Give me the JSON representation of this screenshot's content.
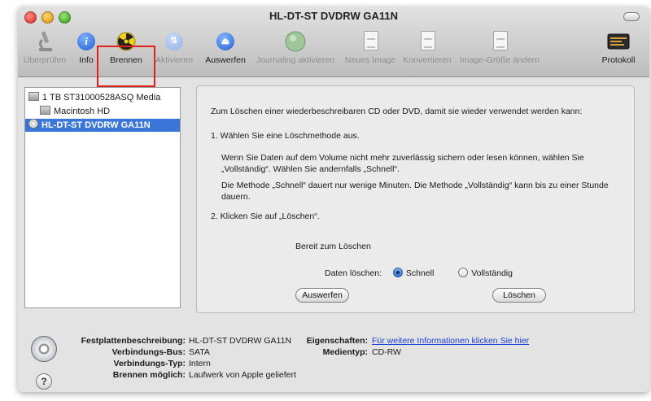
{
  "window": {
    "title": "HL-DT-ST DVDRW GA11N"
  },
  "toolbar": {
    "items": [
      {
        "label": "Überprüfen",
        "icon": "microscope-icon",
        "enabled": false
      },
      {
        "label": "Info",
        "icon": "info-icon",
        "enabled": true
      },
      {
        "label": "Brennen",
        "icon": "burn-icon",
        "enabled": true
      },
      {
        "label": "Aktivieren",
        "icon": "activate-icon",
        "enabled": false
      },
      {
        "label": "Auswerfen",
        "icon": "eject-icon",
        "enabled": true
      },
      {
        "label": "Journaling aktivieren",
        "icon": "journaling-icon",
        "enabled": false
      },
      {
        "label": "Neues Image",
        "icon": "new-image-icon",
        "enabled": false
      },
      {
        "label": "Konvertieren",
        "icon": "convert-icon",
        "enabled": false
      },
      {
        "label": "Image-Größe ändern",
        "icon": "resize-image-icon",
        "enabled": false
      },
      {
        "label": "Protokoll",
        "icon": "log-icon",
        "enabled": true
      }
    ]
  },
  "sidebar": {
    "items": [
      {
        "label": "1 TB ST31000528ASQ Media",
        "icon": "hard-disk-icon",
        "selected": false
      },
      {
        "label": "Macintosh HD",
        "icon": "volume-icon",
        "selected": false
      },
      {
        "label": "HL-DT-ST DVDRW GA11N",
        "icon": "optical-drive-icon",
        "selected": true
      }
    ]
  },
  "panel": {
    "intro": "Zum Löschen einer wiederbeschreibaren CD oder DVD, damit sie wieder verwendet werden kann:",
    "step1": "1. Wählen Sie eine Löschmethode aus.",
    "para1": "Wenn Sie Daten auf dem Volume nicht mehr zuverlässig sichern oder lesen können, wählen Sie „Vollständig“. Wählen Sie andernfalls „Schnell“.",
    "para2": "Die Methode „Schnell“ dauert nur wenige Minuten. Die Methode „Vollständig“ kann bis zu einer Stunde dauern.",
    "step2": "2. Klicken Sie auf „Löschen“.",
    "status": "Bereit zum Löschen",
    "erase_label": "Daten löschen:",
    "option_quick": "Schnell",
    "option_full": "Vollständig",
    "selected_option": "Schnell",
    "eject_button": "Auswerfen",
    "erase_button": "Löschen"
  },
  "footer": {
    "desc_label": "Festplattenbeschreibung:",
    "desc_value": "HL-DT-ST DVDRW GA11N",
    "bus_label": "Verbindungs-Bus:",
    "bus_value": "SATA",
    "type_label": "Verbindungs-Typ:",
    "type_value": "Intern",
    "burn_label": "Brennen möglich:",
    "burn_value": "Laufwerk von Apple geliefert",
    "props_label": "Eigenschaften:",
    "props_link": "Für weitere Informationen klicken Sie hier",
    "media_label": "Medientyp:",
    "media_value": "CD-RW",
    "help": "?"
  },
  "colors": {
    "selection": "#3a76d8",
    "highlight_box": "#e0201c",
    "link": "#1a3fd9"
  }
}
